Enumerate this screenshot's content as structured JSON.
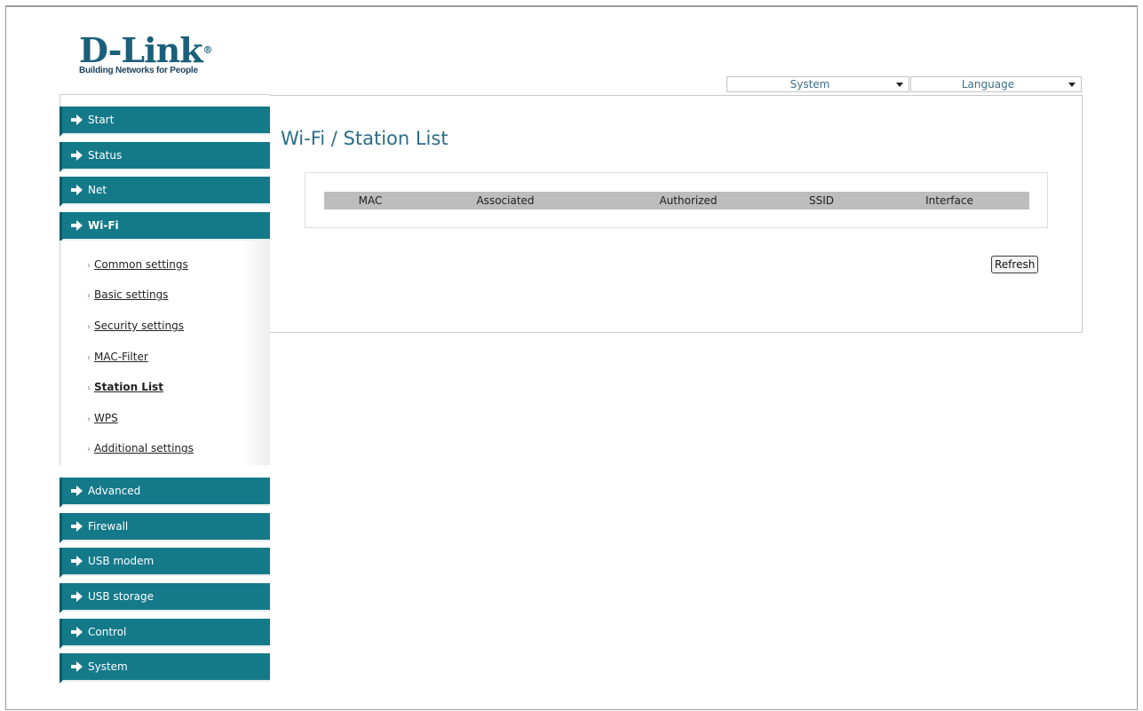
{
  "logo": {
    "brand": "D-Link",
    "registered_mark": "®",
    "tagline": "Building Networks for People"
  },
  "top_selects": {
    "system": {
      "value": "System",
      "icon": "chevron-down-icon"
    },
    "language": {
      "value": "Language",
      "icon": "chevron-down-icon"
    }
  },
  "sidebar": {
    "items": [
      {
        "label": "Start",
        "icon": "arrow-right-icon"
      },
      {
        "label": "Status",
        "icon": "arrow-right-icon"
      },
      {
        "label": "Net",
        "icon": "arrow-right-icon"
      },
      {
        "label": "Wi-Fi",
        "icon": "arrow-right-icon",
        "active": true
      },
      {
        "label": "Advanced",
        "icon": "arrow-right-icon"
      },
      {
        "label": "Firewall",
        "icon": "arrow-right-icon"
      },
      {
        "label": "USB modem",
        "icon": "arrow-right-icon"
      },
      {
        "label": "USB storage",
        "icon": "arrow-right-icon"
      },
      {
        "label": "Control",
        "icon": "arrow-right-icon"
      },
      {
        "label": "System",
        "icon": "arrow-right-icon"
      }
    ],
    "wifi_submenu": [
      {
        "label": "Common settings"
      },
      {
        "label": "Basic settings"
      },
      {
        "label": "Security settings"
      },
      {
        "label": "MAC-Filter"
      },
      {
        "label": "Station List",
        "current": true
      },
      {
        "label": "WPS"
      },
      {
        "label": "Additional settings"
      }
    ],
    "submenu_bullet": "›"
  },
  "main": {
    "title": "Wi-Fi / Station List",
    "table": {
      "columns": [
        "MAC",
        "Associated",
        "Authorized",
        "SSID",
        "Interface"
      ],
      "rows": []
    },
    "refresh_label": "Refresh"
  },
  "colors": {
    "accent": "#147a8a",
    "title": "#2a6d87",
    "header_bg": "#bdbdbd"
  }
}
